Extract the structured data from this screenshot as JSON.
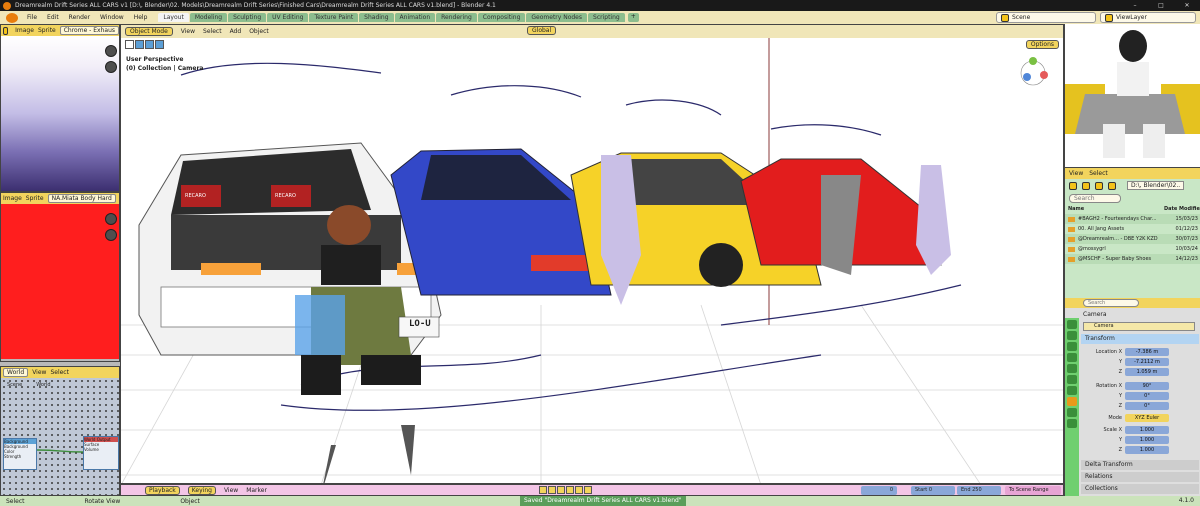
{
  "window": {
    "title": "Dreamrealm Drift Series ALL CARS v1 [D:\\, Blender\\02. Models\\Dreamrealm Drift Series\\Finished Cars\\Dreamrealm Drift Series ALL CARS v1.blend] - Blender 4.1",
    "controls": [
      "–",
      "□",
      "✕"
    ]
  },
  "menu": [
    "File",
    "Edit",
    "Render",
    "Window",
    "Help"
  ],
  "workspaces": [
    {
      "label": "Layout",
      "active": true
    },
    {
      "label": "Modeling"
    },
    {
      "label": "Sculpting"
    },
    {
      "label": "UV Editing"
    },
    {
      "label": "Texture Paint"
    },
    {
      "label": "Shading"
    },
    {
      "label": "Animation"
    },
    {
      "label": "Rendering"
    },
    {
      "label": "Compositing"
    },
    {
      "label": "Geometry Nodes"
    },
    {
      "label": "Scripting"
    }
  ],
  "workspace_add": "+",
  "scene_field": "Scene",
  "viewlayer_field": "ViewLayer",
  "image_editor_top": {
    "menu": [
      "Image",
      "Sprite"
    ],
    "image": "Chrome - Exhaus"
  },
  "image_editor_mid": {
    "menu": [
      "Image",
      "Sprite"
    ],
    "image": "NA.Miata Body Hard"
  },
  "node_editor": {
    "world": "World",
    "menu": [
      "View",
      "Select"
    ],
    "crumbs": [
      "Scene",
      "World"
    ],
    "node1": "Background",
    "node2": "World Output",
    "node1_rows": [
      "Background",
      "Color",
      "Strength"
    ],
    "node2_rows": [
      "Surface",
      "Volume"
    ]
  },
  "viewport": {
    "mode": "Object Mode",
    "menu": [
      "View",
      "Select",
      "Add",
      "Object"
    ],
    "transform": "Global",
    "options": "Options",
    "info_line1": "User Perspective",
    "info_line2": "(0) Collection | Camera",
    "plate": "LO-U",
    "recaro": "RECARO"
  },
  "thumbnail_menu": [
    "View",
    "Select"
  ],
  "file_browser": {
    "path": "D:\\, Blender\\02..",
    "search_placeholder": "Search",
    "header": {
      "name": "Name",
      "date": "Date Modified"
    },
    "rows": [
      {
        "name": "#BAGH2 - Fourteendays Char...",
        "date": "15/03/23"
      },
      {
        "name": "00. All Jang Assets",
        "date": "01/12/23"
      },
      {
        "name": "@Dreamrealm... - DBE Y2K KZD",
        "date": "30/07/23"
      },
      {
        "name": "@mossygrl",
        "date": "10/03/24"
      },
      {
        "name": "@MSCHF - Super Baby Shoes",
        "date": "14/12/23"
      }
    ]
  },
  "properties": {
    "search_placeholder": "Search",
    "breadcrumb": "Camera",
    "object_name": "Camera",
    "transform_label": "Transform",
    "rows": [
      {
        "label": "Location X",
        "value": "-7.386 m"
      },
      {
        "label": "Y",
        "value": "-7.2112 m"
      },
      {
        "label": "Z",
        "value": "1.059 m"
      },
      {
        "label": "Rotation X",
        "value": "90°"
      },
      {
        "label": "Y",
        "value": "0°"
      },
      {
        "label": "Z",
        "value": "0°"
      },
      {
        "label": "Mode",
        "value": "XYZ Euler"
      },
      {
        "label": "Scale X",
        "value": "1.000"
      },
      {
        "label": "Y",
        "value": "1.000"
      },
      {
        "label": "Z",
        "value": "1.000"
      }
    ],
    "delta": "Delta Transform",
    "relations": "Relations",
    "collections": "Collections"
  },
  "timeline": {
    "playback": "Playback",
    "keying": "Keying",
    "menu": [
      "View",
      "Marker"
    ],
    "current": "0",
    "start_label": "Start",
    "start": "0",
    "end_label": "End",
    "end": "250",
    "scene_range": "To Scene Range"
  },
  "statusbar": {
    "select": "Select",
    "rotate": "Rotate View",
    "object": "Object",
    "saved": "Saved \"Dreamrealm Drift Series ALL CARS v1.blend\"",
    "version": "4.1.0"
  },
  "colors": {
    "header_yellow": "#f2d45d",
    "menubar": "#f0e6b8",
    "accent_blue": "#5c9fd6",
    "timeline_pink": "#f3c5e6",
    "texture_red": "#ff1e1e"
  }
}
